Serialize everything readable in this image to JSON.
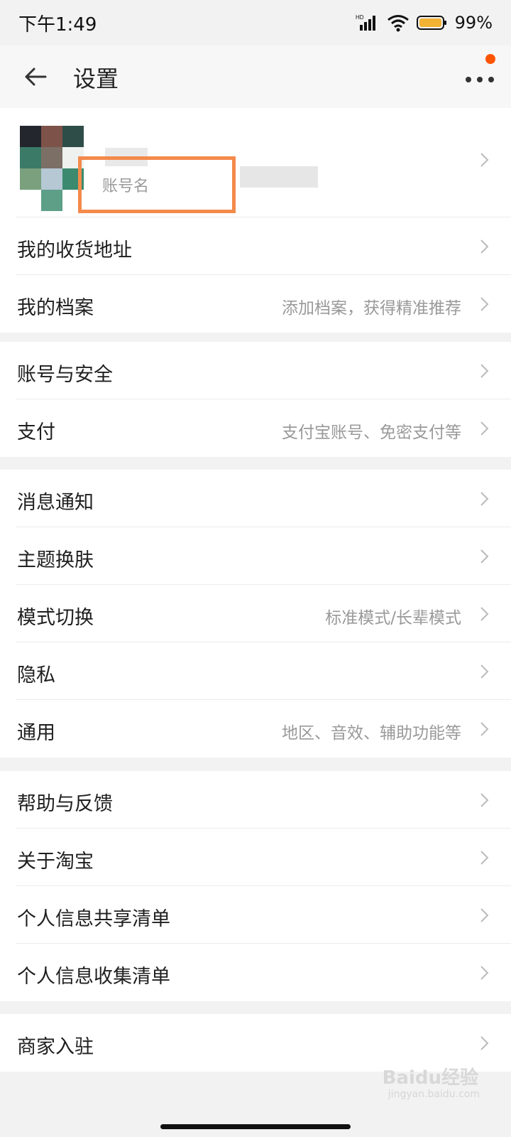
{
  "status": {
    "time": "下午1:49",
    "battery_pct": "99%"
  },
  "nav": {
    "title": "设置"
  },
  "profile": {
    "account_name": "账号名"
  },
  "groups": [
    [
      {
        "label": "我的收货地址",
        "hint": ""
      },
      {
        "label": "我的档案",
        "hint": "添加档案，获得精准推荐"
      }
    ],
    [
      {
        "label": "账号与安全",
        "hint": ""
      },
      {
        "label": "支付",
        "hint": "支付宝账号、免密支付等"
      }
    ],
    [
      {
        "label": "消息通知",
        "hint": ""
      },
      {
        "label": "主题换肤",
        "hint": ""
      },
      {
        "label": "模式切换",
        "hint": "标准模式/长辈模式"
      },
      {
        "label": "隐私",
        "hint": ""
      },
      {
        "label": "通用",
        "hint": "地区、音效、辅助功能等"
      }
    ],
    [
      {
        "label": "帮助与反馈",
        "hint": ""
      },
      {
        "label": "关于淘宝",
        "hint": ""
      },
      {
        "label": "个人信息共享清单",
        "hint": ""
      },
      {
        "label": "个人信息收集清单",
        "hint": ""
      }
    ],
    [
      {
        "label": "商家入驻",
        "hint": ""
      }
    ]
  ],
  "watermark": {
    "text": "Baidu经验",
    "sub": "jingyan.baidu.com"
  },
  "colors": {
    "accent": "#ff5500",
    "highlight": "#f48a4b",
    "background": "#f2f2f2"
  }
}
